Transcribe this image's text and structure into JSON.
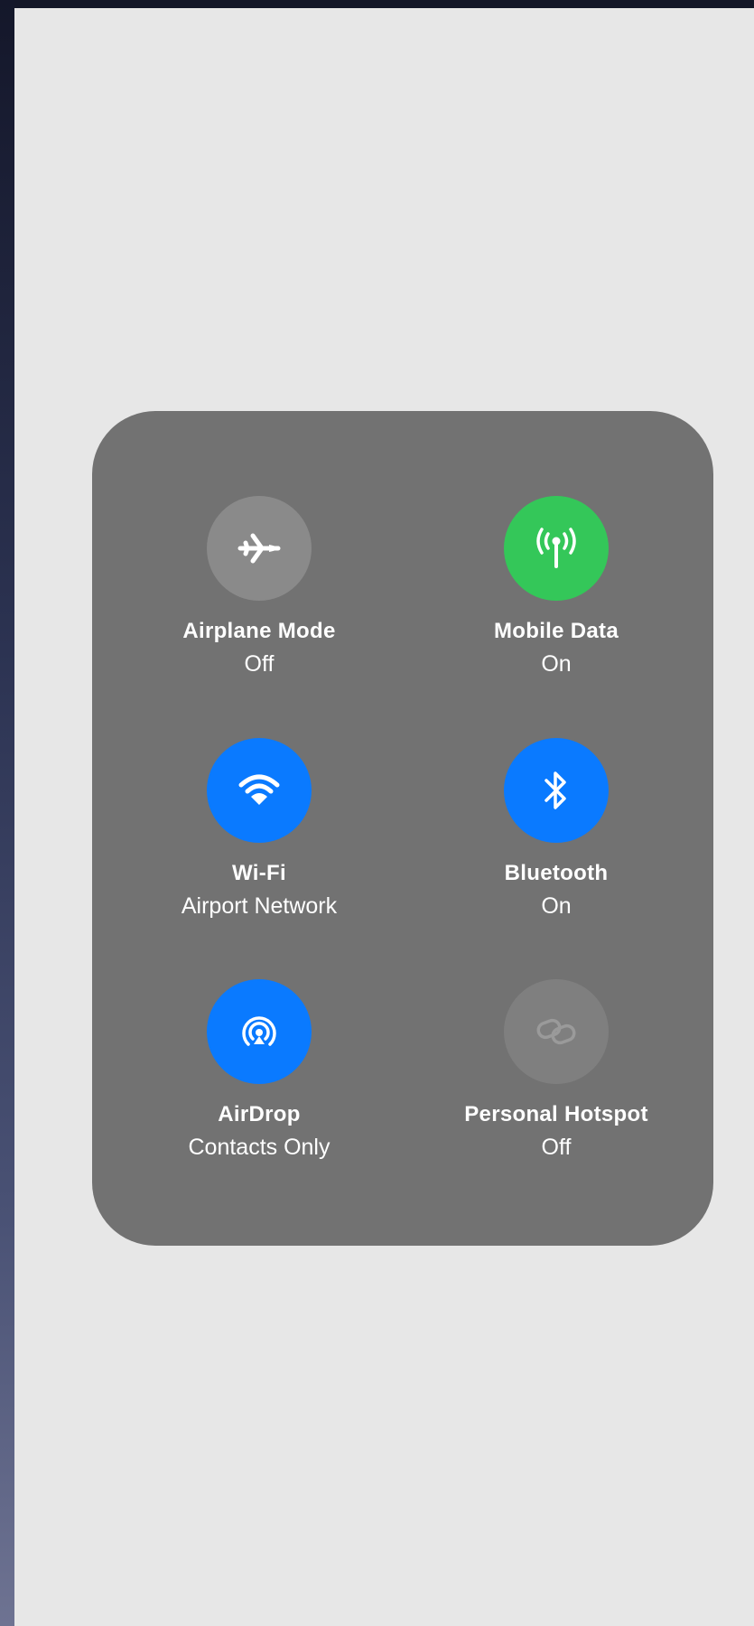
{
  "toggles": [
    {
      "name": "Airplane Mode",
      "status": "Off",
      "icon": "airplane-icon",
      "color": "#8a8a8a"
    },
    {
      "name": "Mobile Data",
      "status": "On",
      "icon": "cellular-antenna-icon",
      "color": "#34c759"
    },
    {
      "name": "Wi-Fi",
      "status": "Airport Network",
      "icon": "wifi-icon",
      "color": "#0a7aff"
    },
    {
      "name": "Bluetooth",
      "status": "On",
      "icon": "bluetooth-icon",
      "color": "#0a7aff"
    },
    {
      "name": "AirDrop",
      "status": "Contacts Only",
      "icon": "airdrop-icon",
      "color": "#0a7aff"
    },
    {
      "name": "Personal Hotspot",
      "status": "Off",
      "icon": "hotspot-link-icon",
      "color": "#7f7f7f"
    }
  ],
  "colors": {
    "screen_background": "#e7e7e7",
    "panel_background": "#727272",
    "label_text": "#ffffff"
  }
}
